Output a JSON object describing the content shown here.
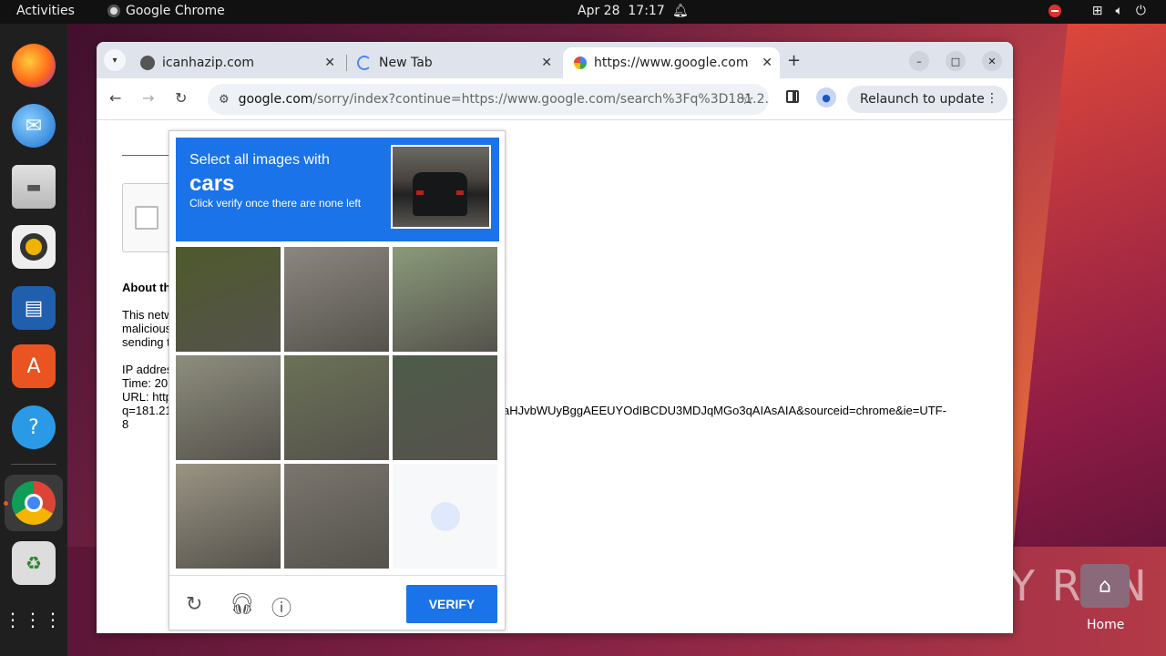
{
  "topbar": {
    "activities": "Activities",
    "app_name": "Google Chrome",
    "date": "Apr 28",
    "time": "17:17"
  },
  "dock": {
    "items": [
      "firefox-icon",
      "thunderbird-icon",
      "files-icon",
      "rhythmbox-icon",
      "writer-icon",
      "app-center-icon",
      "help-icon",
      "chrome-icon",
      "trash-icon",
      "apps-grid-icon"
    ]
  },
  "browser": {
    "tabs": [
      {
        "title": "icanhazip.com"
      },
      {
        "title": "New Tab"
      },
      {
        "title": "https://www.google.com"
      }
    ],
    "address_host": "google.com",
    "address_path": "/sorry/index?continue=https://www.google.com/search%3Fq%3D181.2...",
    "relaunch_label": "Relaunch to update"
  },
  "page": {
    "about_label": "About th",
    "para_lines": [
      "This netw",
      "malicious",
      "sending t"
    ],
    "ip_label": "IP addres",
    "time_label": "Time: 20",
    "url_label": "URL: http",
    "url_tail": "aHJvbWUyBggAEEUYOdIBCDU3MDJqMGo3qAIAsAIA&sourceid=chrome&ie=UTF-",
    "url_start": "q=181.21",
    "url_end": "8"
  },
  "captcha": {
    "instruction": "Select all images with",
    "target": "cars",
    "hint": "Click verify once there are none left",
    "verify_label": "VERIFY",
    "tiles": [
      {
        "bg": "#4e5a2c"
      },
      {
        "bg": "#8c8680"
      },
      {
        "bg": "#8a9a7a"
      },
      {
        "bg": "#8e8e7e"
      },
      {
        "bg": "#6a7256"
      },
      {
        "bg": "#4e5c4a"
      },
      {
        "bg": "#9a9484"
      },
      {
        "bg": "#7a766e"
      },
      {
        "bg": "empty"
      }
    ]
  },
  "watermark": "ANY RUN",
  "home_label": "Home"
}
